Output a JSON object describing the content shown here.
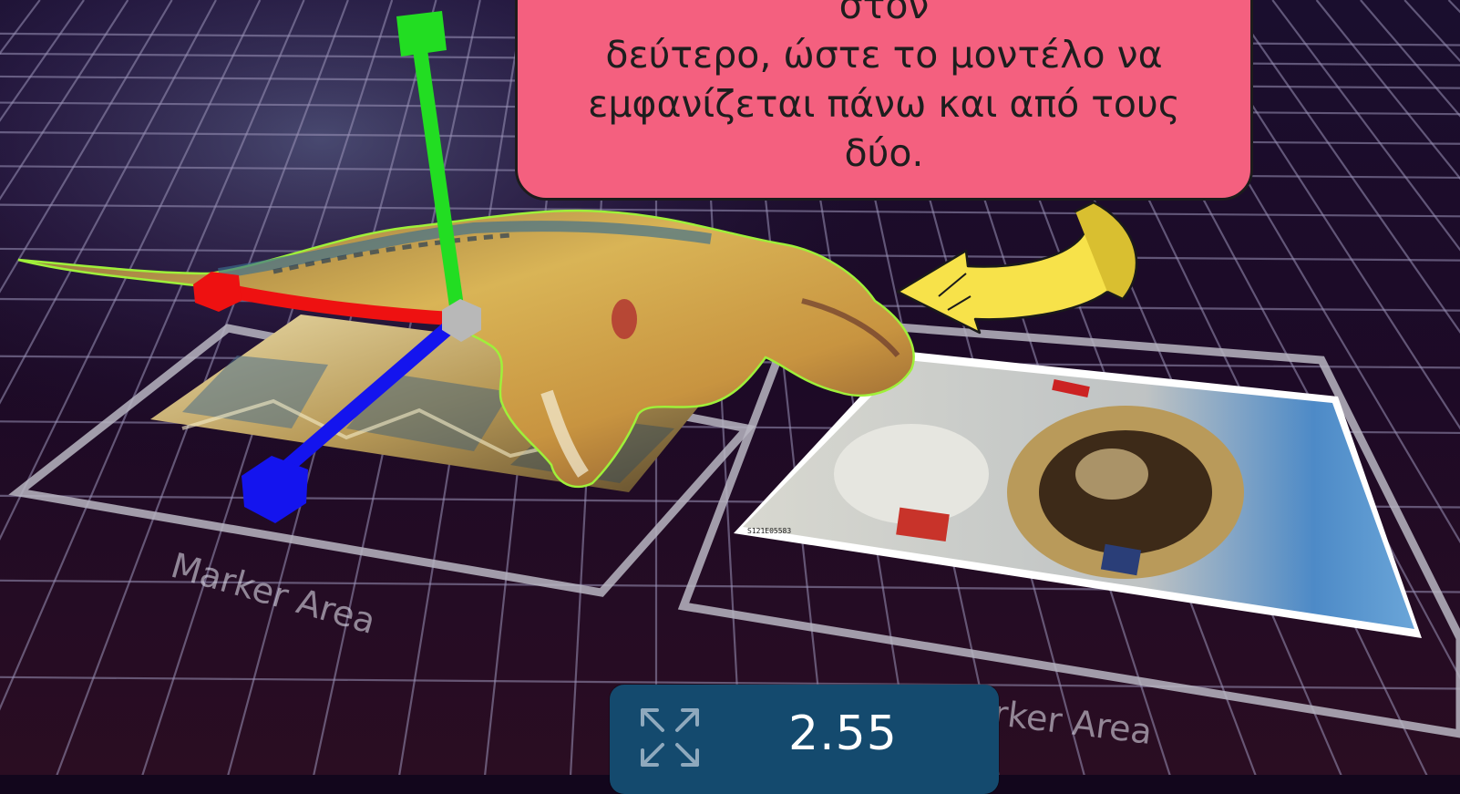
{
  "callout": {
    "text": "τρισδιάστατο μοντέλο στον πρώτο\nδείκτη και τον βάζουμε δίπλα στον\nδεύτερο, ώστε το μοντέλο να\nεμφανίζεται πάνω και από τους δύο."
  },
  "markers": {
    "left_label": "Marker Area",
    "right_label": "rker Area"
  },
  "scale_widget": {
    "icon": "expand-arrows-icon",
    "value": "2.55"
  },
  "gizmo": {
    "y_axis_color": "#22dd22",
    "x_axis_color": "#ee1111",
    "z_axis_color": "#1414ee",
    "center_color": "#b8b8b8"
  },
  "scene_objects": {
    "model": "dinosaur-3d-model",
    "left_marker_image": "ruined-landscape-photo",
    "right_marker_image": "astronaut-photo",
    "arrow": "yellow-curved-arrow-icon"
  }
}
